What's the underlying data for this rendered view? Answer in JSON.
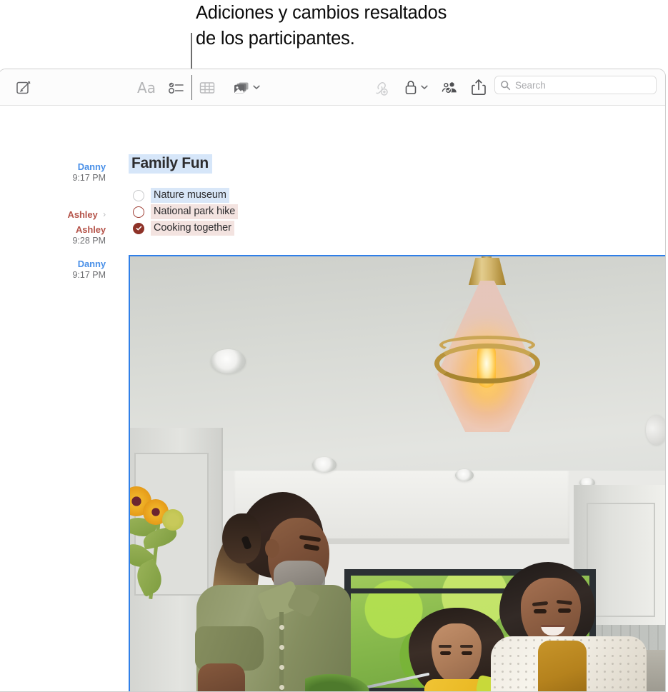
{
  "annotation": {
    "caption": "Adiciones y cambios resaltados\nde los participantes."
  },
  "toolbar": {
    "compose_icon": "compose-icon",
    "format_label": "Aa",
    "checklist_icon": "checklist-icon",
    "table_icon": "table-icon",
    "media_icon": "media-icon",
    "media_chevron_icon": "chevron-down-icon",
    "add_link_icon": "add-link-icon",
    "lock_icon": "lock-icon",
    "lock_chevron_icon": "chevron-down-icon",
    "collaborate_icon": "collaborate-person-icon",
    "share_icon": "share-icon",
    "search": {
      "icon": "search-icon",
      "placeholder": "Search",
      "value": ""
    }
  },
  "note": {
    "title": "Family Fun",
    "authors": [
      {
        "name": "Danny",
        "time": "9:17 PM",
        "color": "#4a90e8",
        "has_chevron": false
      },
      {
        "name": "Ashley",
        "time": "",
        "color": "#b5544a",
        "has_chevron": true
      },
      {
        "name": "Ashley",
        "time": "9:28 PM",
        "color": "#b5544a",
        "has_chevron": false
      },
      {
        "name": "Danny",
        "time": "9:17 PM",
        "color": "#4a90e8",
        "has_chevron": false
      }
    ],
    "checklist": [
      {
        "label": "Nature museum",
        "checked": false,
        "circle": "plain",
        "highlight": "#d9e7f8"
      },
      {
        "label": "National park hike",
        "checked": false,
        "circle": "red",
        "highlight": "#f3e3e0"
      },
      {
        "label": "Cooking together",
        "checked": true,
        "circle": "filled",
        "highlight": "#f3e3e0"
      }
    ],
    "title_highlight": "#d6e6f9",
    "attachment": {
      "name": "family-kitchen-photo",
      "selected": true,
      "selection_color": "#2f7fe8"
    }
  }
}
